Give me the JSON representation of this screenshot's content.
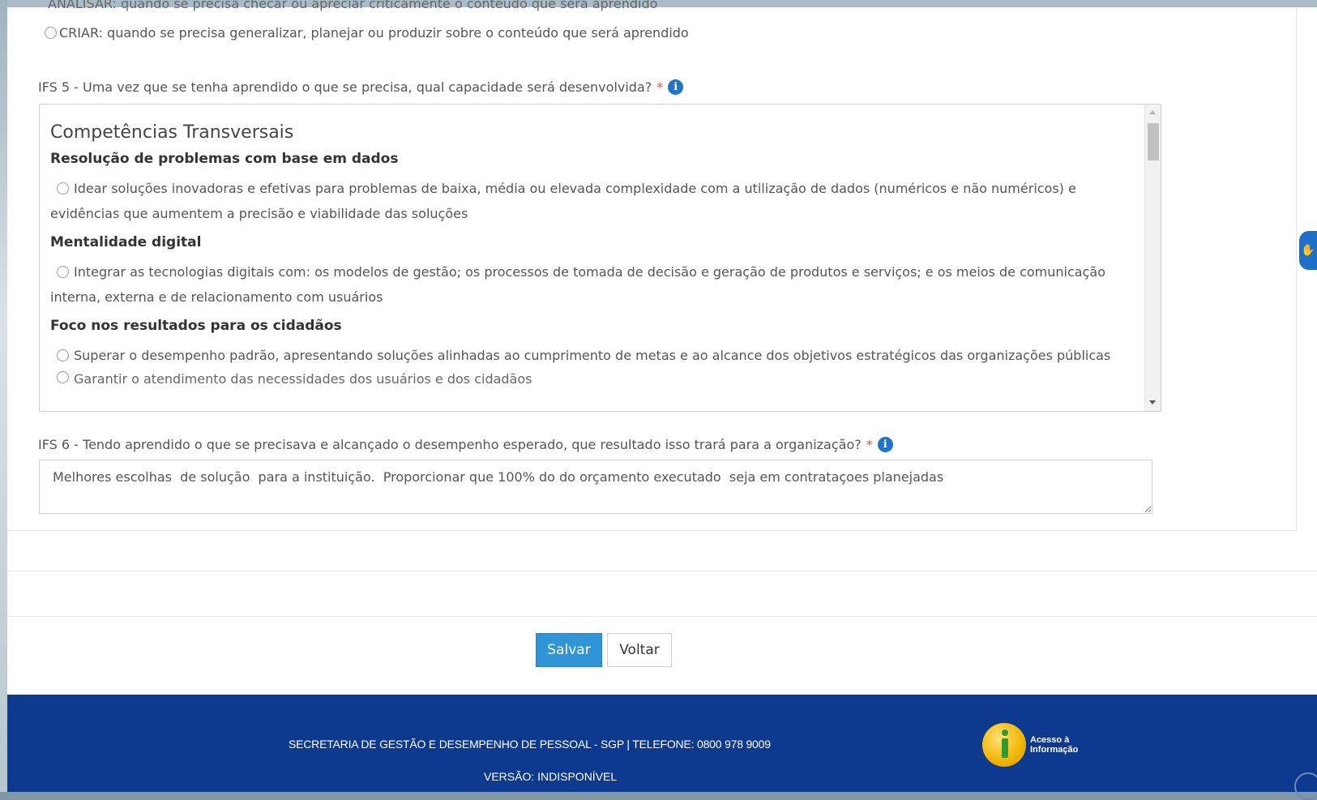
{
  "top_cut_text": "ANALISAR: quando se precisa checar ou apreciar criticamente o conteúdo que será aprendido",
  "criar_option": "CRIAR: quando se precisa generalizar, planejar ou produzir sobre o conteúdo que será aprendido",
  "ifs5": {
    "question": "IFS 5 - Uma vez que se tenha aprendido o que se precisa, qual capacidade será desenvolvida?",
    "required_mark": "*",
    "section_title": "Competências Transversais",
    "groups": [
      {
        "title": "Resolução de problemas com base em dados",
        "option": "Idear soluções inovadoras e efetivas para problemas de baixa, média ou elevada complexidade com a utilização de dados (numéricos e não numéricos) e evidências que aumentem a precisão e viabilidade das soluções"
      },
      {
        "title": "Mentalidade digital",
        "option": "Integrar as tecnologias digitais com: os modelos de gestão; os processos de tomada de decisão e geração de produtos e serviços; e os meios de comunicação interna, externa e de relacionamento com usuários"
      },
      {
        "title": "Foco nos resultados para os cidadãos",
        "option": "Superar o desempenho padrão, apresentando soluções alinhadas ao cumprimento de metas e ao alcance dos objetivos estratégicos das organizações públicas"
      }
    ],
    "cut_option": "Garantir o atendimento das necessidades dos usuários e dos cidadãos"
  },
  "ifs6": {
    "question": "IFS 6 - Tendo aprendido o que se precisava e alcançado o desempenho esperado, que resultado isso trará para a organização?",
    "required_mark": "*",
    "answer": "Melhores escolhas  de solução  para a instituição.  Proporcionar que 100% do do orçamento executado  seja em contrataçoes planejadas"
  },
  "buttons": {
    "save": "Salvar",
    "back": "Voltar"
  },
  "footer": {
    "line1": "SECRETARIA DE GESTÃO E DESEMPENHO DE PESSOAL - SGP | TELEFONE: 0800 978 9009",
    "line2": "VERSÃO: INDISPONÍVEL",
    "acesso_line1": "Acesso à",
    "acesso_line2": "Informação"
  },
  "icons": {
    "info": "info-circle-icon",
    "accessibility": "hand-sign-language-icon",
    "scroll_top": "arrow-up-circle-icon"
  },
  "colors": {
    "primary_button": "#2f95d6",
    "info_icon": "#1f73c9",
    "required": "#d9534f",
    "footer_bg": "#0d3a8e"
  }
}
